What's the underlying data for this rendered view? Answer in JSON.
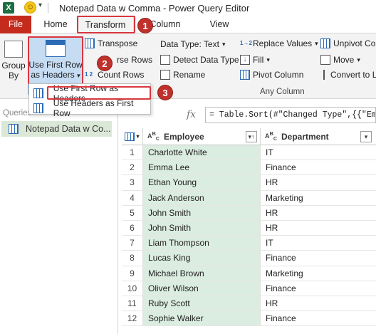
{
  "window": {
    "title": "Notepad Data w Comma - Power Query Editor"
  },
  "quick_access": {
    "app_icon": "excel-icon",
    "smiley": "smiley-icon"
  },
  "tabs": [
    {
      "label": "File"
    },
    {
      "label": "Home"
    },
    {
      "label": "Transform"
    },
    {
      "label": "Add Column",
      "visible_text": "d Column"
    },
    {
      "label": "View"
    }
  ],
  "ribbon": {
    "group_by": {
      "line1": "Group",
      "line2": "By"
    },
    "use_first_row": {
      "line1": "Use First Row",
      "line2": "as Headers"
    },
    "transpose": "Transpose",
    "reverse_rows": "rse Rows",
    "count_rows": "Count Rows",
    "data_type": "Data Type: Text",
    "detect_data_type": "Detect Data Type",
    "rename": "Rename",
    "replace_values": "Replace Values",
    "fill": "Fill",
    "pivot_column": "Pivot Column",
    "unpivot": "Unpivot Col",
    "move": "Move",
    "convert": "Convert to L",
    "group_label": "Any Column"
  },
  "dropdown": {
    "item1": "Use First Row as Headers",
    "item2": "Use Headers as First Row"
  },
  "badges": [
    "1",
    "2",
    "3"
  ],
  "queries": {
    "label": "Queries",
    "item": "Notepad Data w Co..."
  },
  "formula": {
    "fx": "fx",
    "text": "= Table.Sort(#\"Changed Type\",{{\"Emp"
  },
  "table": {
    "columns": [
      "Employee",
      "Department"
    ],
    "rows": [
      {
        "n": "1",
        "employee": "Charlotte White",
        "department": "IT"
      },
      {
        "n": "2",
        "employee": "Emma Lee",
        "department": "Finance"
      },
      {
        "n": "3",
        "employee": "Ethan Young",
        "department": "HR"
      },
      {
        "n": "4",
        "employee": "Jack Anderson",
        "department": "Marketing"
      },
      {
        "n": "5",
        "employee": "John Smith",
        "department": "HR"
      },
      {
        "n": "6",
        "employee": "John Smith",
        "department": "HR"
      },
      {
        "n": "7",
        "employee": "Liam Thompson",
        "department": "IT"
      },
      {
        "n": "8",
        "employee": "Lucas King",
        "department": "Finance"
      },
      {
        "n": "9",
        "employee": "Michael Brown",
        "department": "Marketing"
      },
      {
        "n": "10",
        "employee": "Oliver Wilson",
        "department": "Finance"
      },
      {
        "n": "11",
        "employee": "Ruby Scott",
        "department": "HR"
      },
      {
        "n": "12",
        "employee": "Sophie Walker",
        "department": "Finance"
      }
    ]
  },
  "colors": {
    "file_tab": "#c42b1c",
    "highlight": "#d9363e",
    "selected_column": "#dbece0",
    "query_selected": "#dbe8d8"
  }
}
